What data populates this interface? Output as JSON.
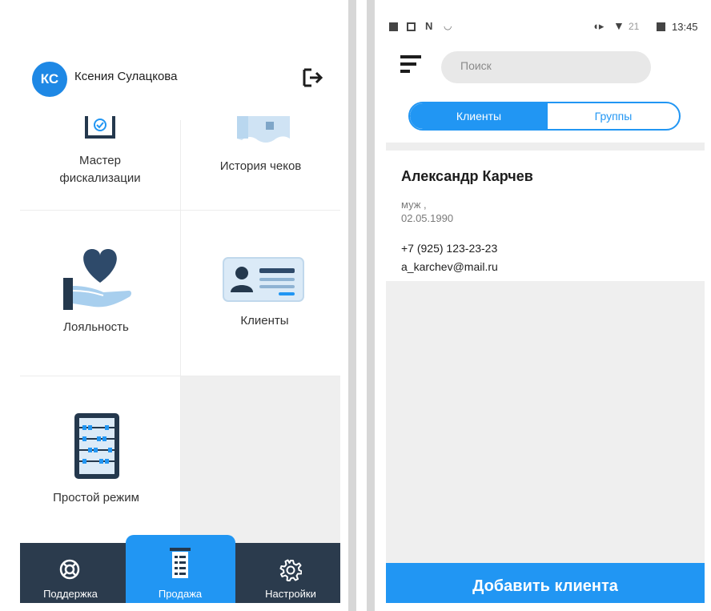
{
  "left": {
    "user": {
      "initials": "КС",
      "name": "Ксения Сулацкова"
    },
    "tiles": [
      {
        "label": "Мастер\nфискализации",
        "icon": "fiscal-master-icon"
      },
      {
        "label": "История чеков",
        "icon": "receipt-history-icon"
      },
      {
        "label": "Лояльность",
        "icon": "loyalty-icon"
      },
      {
        "label": "Клиенты",
        "icon": "clients-card-icon"
      },
      {
        "label": "Простой режим",
        "icon": "abacus-icon"
      }
    ],
    "bottom_nav": [
      {
        "label": "Поддержка",
        "icon": "lifebuoy-icon"
      },
      {
        "label": "Продажа",
        "icon": "sale-receipt-icon",
        "active": true
      },
      {
        "label": "Настройки",
        "icon": "gear-icon"
      }
    ]
  },
  "right": {
    "status_bar": {
      "time": "13:45",
      "signal_text": "21"
    },
    "search": {
      "placeholder": "Поиск"
    },
    "tabs": [
      {
        "label": "Клиенты",
        "active": true
      },
      {
        "label": "Группы",
        "active": false
      }
    ],
    "client": {
      "name": "Александр Карчев",
      "gender": "муж ,",
      "birthdate": "02.05.1990",
      "phone": "+7 (925) 123-23-23",
      "email": "a_karchev@mail.ru"
    },
    "add_button_label": "Добавить клиента"
  },
  "colors": {
    "accent": "#2196f3",
    "nav_bg": "#2b3b4d",
    "avatar": "#1e88e5"
  }
}
